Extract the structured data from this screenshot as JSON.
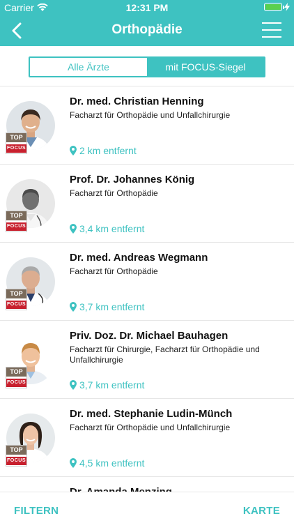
{
  "status": {
    "carrier": "Carrier",
    "time": "12:31 PM",
    "battery_level": 1.0
  },
  "nav": {
    "title": "Orthopädie"
  },
  "segments": [
    {
      "label": "Alle Ärzte",
      "selected": false
    },
    {
      "label": "mit FOCUS-Siegel",
      "selected": true
    }
  ],
  "badge": {
    "top": "TOP",
    "focus": "FOCUS"
  },
  "doctors": [
    {
      "name": "Dr. med. Christian Henning",
      "specialty": "Facharzt für Orthopädie und Unfallchirurgie",
      "distance": "2 km entfernt"
    },
    {
      "name": "Prof. Dr. Johannes König",
      "specialty": "Facharzt für Orthopädie",
      "distance": "3,4 km entfernt"
    },
    {
      "name": "Dr. med. Andreas Wegmann",
      "specialty": "Facharzt für Orthopädie",
      "distance": "3,7 km entfernt"
    },
    {
      "name": "Priv. Doz. Dr. Michael Bauhagen",
      "specialty": "Facharzt für Chirurgie, Facharzt für Orthopädie und Unfallchirurgie",
      "distance": "3,7 km entfernt"
    },
    {
      "name": "Dr. med. Stephanie Ludin-Münch",
      "specialty": "Facharzt für Orthopädie und Unfallchirurgie",
      "distance": "4,5 km entfernt"
    },
    {
      "name": "Dr. Amanda Menzing",
      "specialty": "",
      "distance": ""
    }
  ],
  "footer": {
    "filter_label": "FILTERN",
    "map_label": "KARTE"
  },
  "colors": {
    "accent": "#3ec2c1",
    "focus_red": "#c8202e",
    "top_brown": "#7a6a5a"
  }
}
